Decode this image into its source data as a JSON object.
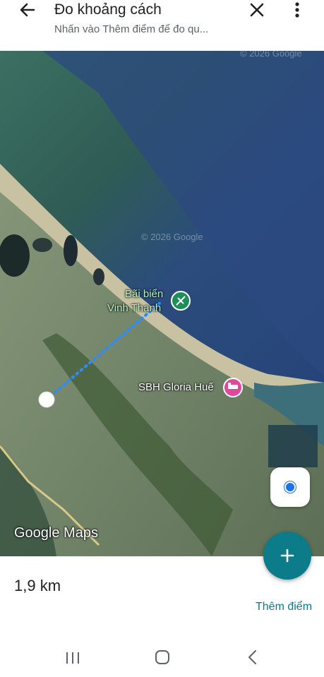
{
  "header": {
    "title": "Đo khoảng cách",
    "subtitle": "Nhấn vào Thêm điểm để đo qu...",
    "back_icon": "arrow-back-icon",
    "close_icon": "close-icon",
    "more_icon": "more-vert-icon"
  },
  "map": {
    "view": "satellite",
    "labels": {
      "beach_line1": "Bãi biển",
      "beach_line2": "Vinh Thanh",
      "hotel": "SBH Gloria Huế"
    },
    "copyright_top": "© 2026 Google",
    "copyright_mid": "© 2026 Google",
    "brand": "Google Maps",
    "poi_icons": [
      "beach-poi-icon",
      "hotel-poi-icon"
    ],
    "colors": {
      "measure_line": "#2a8cff",
      "beach_pin": "#1e8e5a",
      "hotel_pin": "#e0489a"
    }
  },
  "controls": {
    "my_location_icon": "my-location-icon",
    "add_point_icon": "plus-icon"
  },
  "bottom": {
    "distance": "1,9 km",
    "add_point_label": "Thêm điểm"
  },
  "navbar": {
    "recent_icon": "recent-apps-icon",
    "home_icon": "home-icon",
    "back_icon": "system-back-icon"
  }
}
